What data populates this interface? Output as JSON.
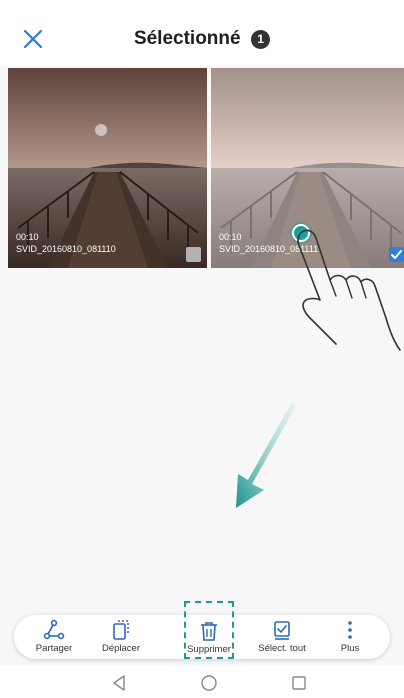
{
  "header": {
    "title": "Sélectionné",
    "selected_count": "1",
    "close_icon": "close-icon"
  },
  "thumbnails": [
    {
      "duration": "00:10",
      "filename": "SVID_20160810_081110",
      "selected": false
    },
    {
      "duration": "00:10",
      "filename": "SVID_20160810_081111",
      "selected": true
    }
  ],
  "toolbar": {
    "items": [
      {
        "label": "Partager",
        "icon": "share-icon"
      },
      {
        "label": "Déplacer",
        "icon": "move-icon"
      },
      {
        "label": "Supprimer",
        "icon": "trash-icon",
        "highlighted": true
      },
      {
        "label": "Sélect. tout",
        "icon": "select-all-icon"
      },
      {
        "label": "Plus",
        "icon": "more-vertical-icon"
      }
    ]
  },
  "navbar": {
    "icons": [
      "back-icon",
      "home-icon",
      "recent-apps-icon"
    ]
  },
  "colors": {
    "accent": "#2d7fd8",
    "highlight": "#1e9b98",
    "toolbar_icon": "#2b6cb0"
  }
}
